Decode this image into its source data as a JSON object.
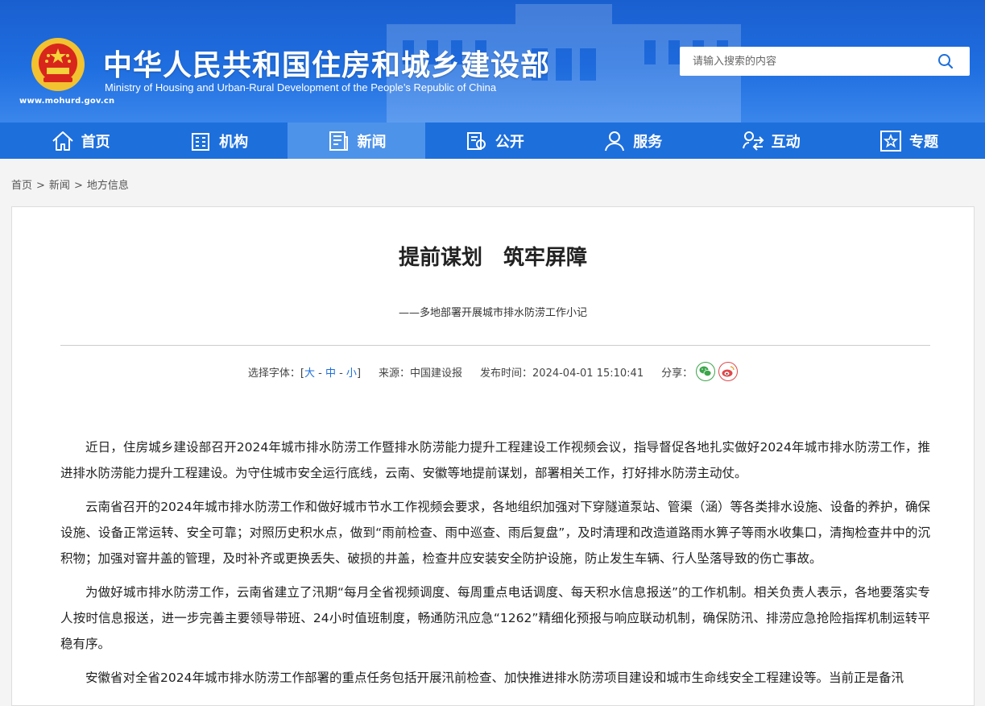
{
  "header": {
    "title_cn": "中华人民共和国住房和城乡建设部",
    "title_en": "Ministry of Housing and Urban-Rural Development of the People’s Republic of China",
    "site_url": "www.mohurd.gov.cn",
    "search_placeholder": "请输入搜索的内容",
    "brand_color": "#1d6fdc"
  },
  "nav": {
    "items": [
      {
        "label": "首页",
        "icon": "home-icon"
      },
      {
        "label": "机构",
        "icon": "building-icon"
      },
      {
        "label": "新闻",
        "icon": "news-icon",
        "active": true
      },
      {
        "label": "公开",
        "icon": "document-icon"
      },
      {
        "label": "服务",
        "icon": "service-person-icon"
      },
      {
        "label": "互动",
        "icon": "interaction-icon"
      },
      {
        "label": "专题",
        "icon": "star-topic-icon"
      }
    ]
  },
  "breadcrumb": {
    "items": [
      "首页",
      "新闻",
      "地方信息"
    ],
    "separator": ">"
  },
  "article": {
    "title": "提前谋划　筑牢屏障",
    "subtitle": "——多地部署开展城市排水防涝工作小记",
    "meta": {
      "font_label": "选择字体：[",
      "font_large": "大",
      "font_medium": "中",
      "font_small": "小",
      "font_sep": " - ",
      "font_close": "]",
      "source": "来源：中国建设报",
      "publish_time": "发布时间：2024-04-01 15:10:41",
      "share_label": "分享："
    },
    "paragraphs": [
      "近日，住房城乡建设部召开2024年城市排水防涝工作暨排水防涝能力提升工程建设工作视频会议，指导督促各地扎实做好2024年城市排水防涝工作，推进排水防涝能力提升工程建设。为守住城市安全运行底线，云南、安徽等地提前谋划，部署相关工作，打好排水防涝主动仗。",
      "云南省召开的2024年城市排水防涝工作和做好城市节水工作视频会要求，各地组织加强对下穿隧道泵站、管渠（涵）等各类排水设施、设备的养护，确保设施、设备正常运转、安全可靠；对照历史积水点，做到“雨前检查、雨中巡查、雨后复盘”，及时清理和改造道路雨水箅子等雨水收集口，清掏检查井中的沉积物；加强对窨井盖的管理，及时补齐或更换丢失、破损的井盖，检查井应安装安全防护设施，防止发生车辆、行人坠落导致的伤亡事故。",
      "为做好城市排水防涝工作，云南省建立了汛期“每月全省视频调度、每周重点电话调度、每天积水信息报送”的工作机制。相关负责人表示，各地要落实专人按时信息报送，进一步完善主要领导带班、24小时值班制度，畅通防汛应急“1262”精细化预报与响应联动机制，确保防汛、排涝应急抢险指挥机制运转平稳有序。",
      "安徽省对全省2024年城市排水防涝工作部署的重点任务包括开展汛前检查、加快推进排水防涝项目建设和城市生命线安全工程建设等。当前正是备汛"
    ]
  }
}
